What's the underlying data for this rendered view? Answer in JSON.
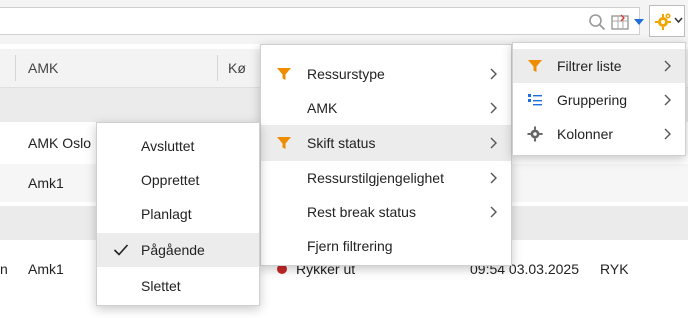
{
  "grid": {
    "headers": [
      "AMK",
      "Kø"
    ],
    "rows": [
      {
        "amk": "AMK Oslo"
      },
      {
        "amk": "Amk1"
      },
      {
        "prefix": "n",
        "amk": "Amk1",
        "status": "Rykker ut",
        "time": "09:54 03.03.2025",
        "code": "RYK"
      }
    ]
  },
  "filter_menu": {
    "items": [
      "Filtrer liste",
      "Gruppering",
      "Kolonner"
    ]
  },
  "attribute_menu": {
    "items": [
      "Ressurstype",
      "AMK",
      "Skift status",
      "Ressurstilgjengelighet",
      "Rest break status",
      "Fjern filtrering"
    ]
  },
  "status_menu": {
    "items": [
      {
        "label": "Avsluttet",
        "checked": false
      },
      {
        "label": "Opprettet",
        "checked": false
      },
      {
        "label": "Planlagt",
        "checked": false
      },
      {
        "label": "Pågående",
        "checked": true
      },
      {
        "label": "Slettet",
        "checked": false
      }
    ]
  },
  "colors": {
    "filter_icon": "#f08c00",
    "gear_icon": "#f0a500",
    "accent_blue": "#1e6fd9",
    "status_dot": "#c62828"
  }
}
